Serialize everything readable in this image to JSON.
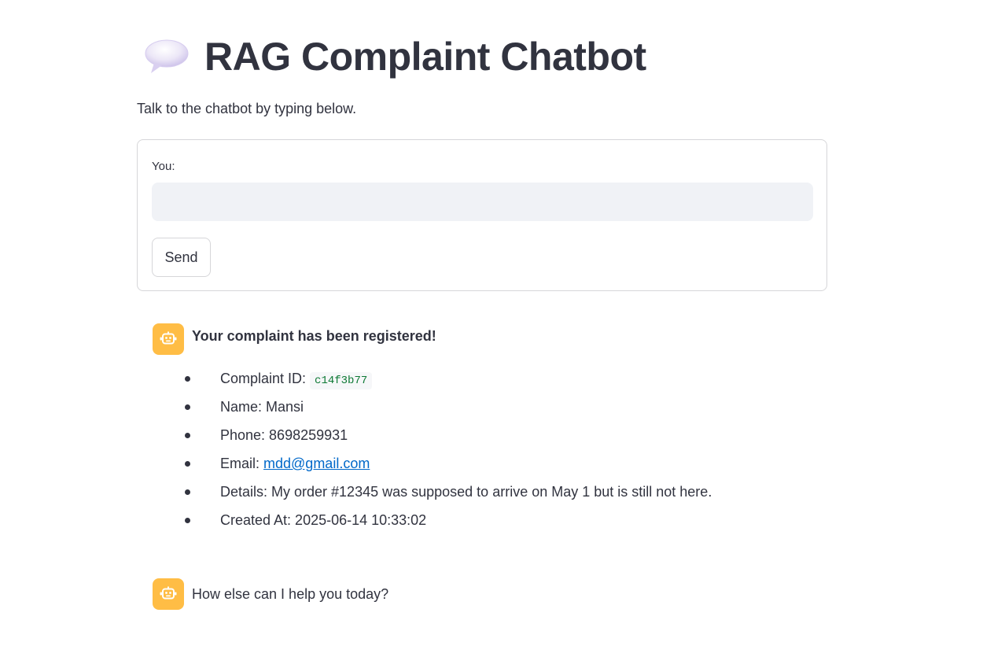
{
  "header": {
    "title": "RAG Complaint Chatbot",
    "icon": "speech-balloon-icon"
  },
  "subtitle": "Talk to the chatbot by typing below.",
  "form": {
    "input_label": "You:",
    "input_value": "",
    "input_placeholder": "",
    "send_label": "Send"
  },
  "messages": [
    {
      "role": "assistant",
      "avatar_icon": "robot-icon",
      "heading": "Your complaint has been registered!",
      "details": {
        "complaint_id_label": "Complaint ID: ",
        "complaint_id": "c14f3b77",
        "name": "Name: Mansi",
        "phone": "Phone: 8698259931",
        "email_label": "Email: ",
        "email": "mdd@gmail.com",
        "details": "Details: My order #12345 was supposed to arrive on May 1 but is still not here.",
        "created_at": "Created At: 2025-06-14 10:33:02"
      }
    },
    {
      "role": "assistant",
      "avatar_icon": "robot-icon",
      "text": "How else can I help you today?"
    }
  ],
  "colors": {
    "avatar_bg": "#ffbd45",
    "text": "#31333f",
    "link": "#0068c9",
    "code_text": "#0f7a36",
    "input_bg": "#f0f2f6",
    "border": "#d6d6d9"
  }
}
